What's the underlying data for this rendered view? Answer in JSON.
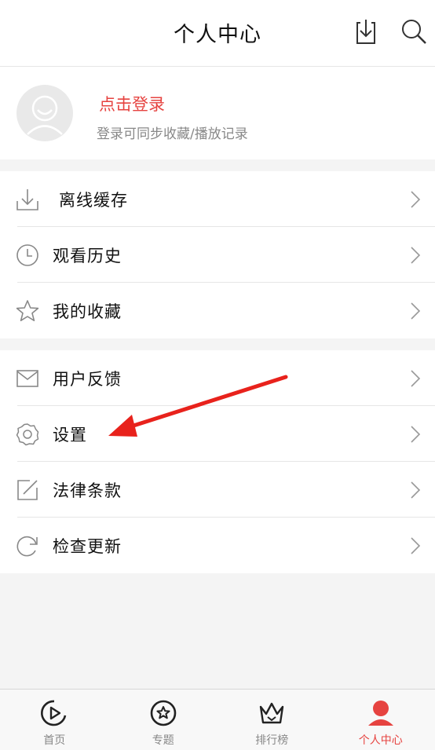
{
  "header": {
    "title": "个人中心",
    "icons": [
      "download-icon",
      "search-icon"
    ]
  },
  "profile": {
    "login_label": "点击登录",
    "login_hint": "登录可同步收藏/播放记录"
  },
  "menu_group_1": [
    {
      "label": "离线缓存",
      "icon": "download-icon"
    },
    {
      "label": "观看历史",
      "icon": "clock-icon"
    },
    {
      "label": "我的收藏",
      "icon": "star-icon"
    }
  ],
  "menu_group_2": [
    {
      "label": "用户反馈",
      "icon": "mail-icon"
    },
    {
      "label": "设置",
      "icon": "gear-icon"
    },
    {
      "label": "法律条款",
      "icon": "edit-icon"
    },
    {
      "label": "检查更新",
      "icon": "refresh-icon"
    }
  ],
  "tabbar": [
    {
      "label": "首页",
      "icon": "play-circle-icon",
      "active": false
    },
    {
      "label": "专题",
      "icon": "star-circle-icon",
      "active": false
    },
    {
      "label": "排行榜",
      "icon": "crown-icon",
      "active": false
    },
    {
      "label": "个人中心",
      "icon": "person-icon",
      "active": true
    }
  ],
  "colors": {
    "accent": "#e64340",
    "text": "#111111",
    "muted": "#888888",
    "background": "#f4f4f4",
    "divider": "#e6e6e6",
    "annotation_arrow": "#e8221c"
  }
}
